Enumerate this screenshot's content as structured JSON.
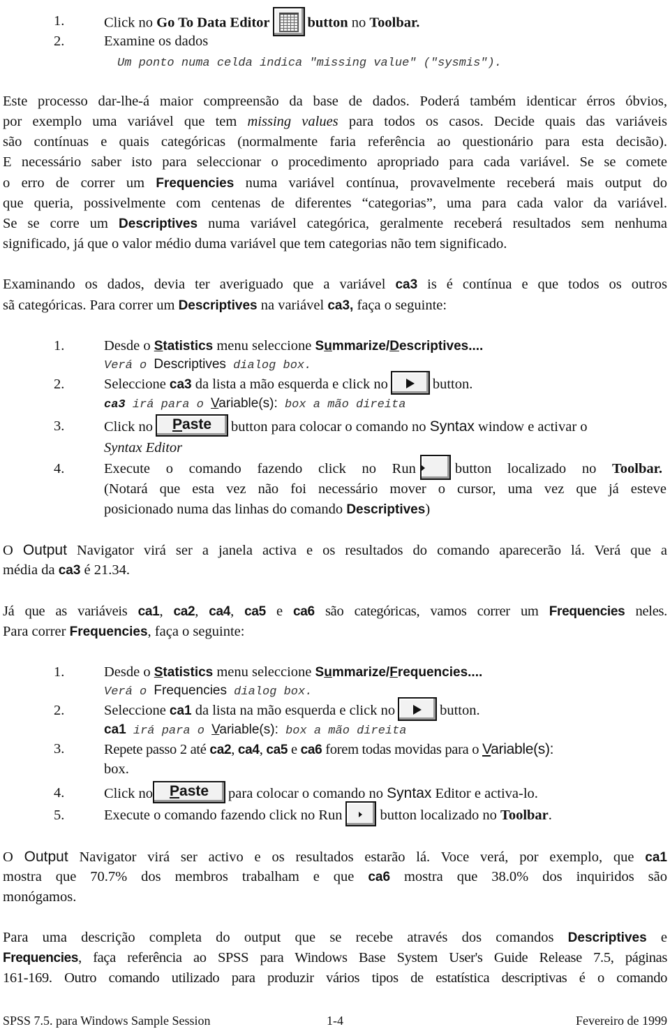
{
  "list1": {
    "items": [
      {
        "num": "1.",
        "pre": "Click no ",
        "bold1": "Go To Data Editor",
        "icon": "data-editor-grid-icon",
        "bold_button": "button",
        "mid": " no ",
        "bold2": "Toolbar."
      },
      {
        "num": "2.",
        "text": "Examine os dados",
        "note": "Um ponto numa celda indica \"missing value\" (\"sysmis\")."
      }
    ]
  },
  "para1": {
    "lines": [
      {
        "pre": "Este processo dar-lhe-á maior compreensão da base de dados.  Poderá também identicar érros óbvios,"
      },
      {
        "pre": "por exemplo uma variável que tem ",
        "ital": "missing values",
        "post": " para todos os casos.  Decide quais das variáveis"
      },
      {
        "pre": "são contínuas e quais categóricas (normalmente faria referência ao questionário para esta decisão)."
      },
      {
        "pre": "E necessário saber isto para seleccionar o procedimento apropriado para cada variável.  Se se comete"
      },
      {
        "pre": "o erro de correr um ",
        "bold": "Frequencies",
        "post": " numa variável contínua, provavelmente receberá mais output do"
      },
      {
        "pre": "que queria, possivelmente com centenas de diferentes “categorias”, uma para cada valor da variável."
      },
      {
        "pre": "Se se corre um ",
        "bold": "Descriptives",
        "post": " numa variável categórica, geralmente receberá resultados sem nenhuma"
      },
      {
        "pre": "significado, já que o valor médio duma variável que tem categorias não tem significado."
      }
    ]
  },
  "para2": {
    "line1": {
      "pre": "Examinando os dados, devia ter averiguado que a variável ",
      "bold": "ca3",
      "post": " is é contínua e que todos os outros"
    },
    "line2": {
      "pre": "sã categóricas.  Para correr um ",
      "bold1": "Descriptives",
      "mid": " na variável ",
      "bold2": "ca3,",
      "post": " faça o seguinte:"
    }
  },
  "list2": {
    "step1": {
      "num": "1.",
      "pre": "Desde o ",
      "menu_u": "S",
      "menu_rest": "tatistics",
      "mid": " menu seleccione ",
      "path_a": "S",
      "path_u": "u",
      "path_b": "mmarize/",
      "path_u2": "D",
      "path_c": "escriptives....",
      "note_a": "Verá o ",
      "note_b": "Descriptives",
      "note_c": " dialog box."
    },
    "step2": {
      "num": "2.",
      "pre": "Seleccione ",
      "bold": "ca3",
      "mid": " da lista a mão esquerda e click no",
      "post": "button.",
      "note_bold": "ca3",
      "note_a": " irá para o ",
      "note_u": "V",
      "note_b": "ariable(s):",
      "note_c": " box a mão direita"
    },
    "step3": {
      "num": "3.",
      "pre": "Click no",
      "paste_u": "P",
      "paste_rest": "aste",
      "mid": "button para colocar o comando no ",
      "sans": "Syntax",
      "post": " window e activar o",
      "line2": "Syntax Editor"
    },
    "step4": {
      "num": "4.",
      "pre": "Execute o comando fazendo click no Run",
      "post": "button localizado no ",
      "bold": "Toolbar.",
      "line2": "(Notará que esta vez não foi necessário mover o cursor, uma vez que já esteve",
      "line3_pre": "posicionado numa das linhas do comando ",
      "line3_bold": "Descriptives",
      "line3_post": ")"
    }
  },
  "para3": {
    "line1_a": "O ",
    "line1_sans": "Output",
    "line1_b": " Navigator virá ser a janela activa e os resultados do comando aparecerão lá.  Verá que a",
    "line2_a": "média da ",
    "line2_bold": "ca3",
    "line2_b": " é 21.34."
  },
  "para4": {
    "pre": "Já que as variáveis ",
    "v1": "ca1",
    "c1": ", ",
    "v2": "ca2",
    "c2": ", ",
    "v3": "ca4",
    "c3": ", ",
    "v4": "ca5",
    "c4": " e ",
    "v5": "ca6",
    "mid": " são categóricas, vamos correr um ",
    "bold": "Frequencies",
    "post": " neles.",
    "line2_pre": "Para correr ",
    "line2_bold": "Frequencies",
    "line2_post": ", faça o seguinte:"
  },
  "list3": {
    "step1": {
      "num": "1.",
      "pre": "Desde o ",
      "menu_u": "S",
      "menu_rest": "tatistics",
      "mid": " menu seleccione ",
      "path_a": "S",
      "path_u": "u",
      "path_b": "mmarize/",
      "path_u2": "F",
      "path_c": "requencies....",
      "note_a": "Verá o ",
      "note_b": "Frequencies",
      "note_c": " dialog box."
    },
    "step2": {
      "num": "2.",
      "pre": "Seleccione ",
      "bold": "ca1",
      "mid": " da lista na mão esquerda e click no",
      "post": "button.",
      "note_bold": "ca1",
      "note_a": " irá para o ",
      "note_u": "V",
      "note_b": "ariable(s):",
      "note_c": " box a mão direita"
    },
    "step3": {
      "num": "3.",
      "pre": "Repete passo 2 até ",
      "b1": "ca2",
      "s1": ", ",
      "b2": "ca4",
      "s2": ", ",
      "b3": "ca5",
      "s3": " e ",
      "b4": "ca6",
      "mid": " forem todas movidas para o ",
      "u": "V",
      "sans_rest": "ariable(s):",
      "line2": "box."
    },
    "step4": {
      "num": "4.",
      "pre": "Click no",
      "paste_u": "P",
      "paste_rest": "aste",
      "mid": "para colocar o comando no ",
      "sans": "Syntax",
      "post": " Editor e activa-lo."
    },
    "step5": {
      "num": "5.",
      "pre": "Execute o comando fazendo click no Run",
      "post": "button localizado no ",
      "bold": "Toolbar",
      "end": "."
    }
  },
  "para5": {
    "line1_a": "O ",
    "line1_sans": "Output",
    "line1_b": " Navigator virá ser activo e os resultados estarão lá.  Voce verá, por exemplo, que ",
    "line1_bold": "ca1",
    "line2_a": "mostra que 70.7% dos membros trabalham e que ",
    "line2_bold": "ca6",
    "line2_b": " mostra que 38.0% dos inquiridos são",
    "line3": "monógamos."
  },
  "para6": {
    "line1_a": "Para uma descrição completa do output que se recebe através dos comandos ",
    "line1_bold": "Descriptives",
    "line1_b": " e",
    "line2_bold": "Frequencies",
    "line2_a": ", faça referência ao SPSS para Windows Base System User's Guide Release 7.5, páginas",
    "line3": "161-169.  Outro comando utilizado para produzir vários tipos de estatística descriptivas é o comando"
  },
  "footer": {
    "left": "SPSS 7.5. para Windows Sample Session",
    "center": "1-4",
    "right": "Fevereiro de 1999"
  }
}
